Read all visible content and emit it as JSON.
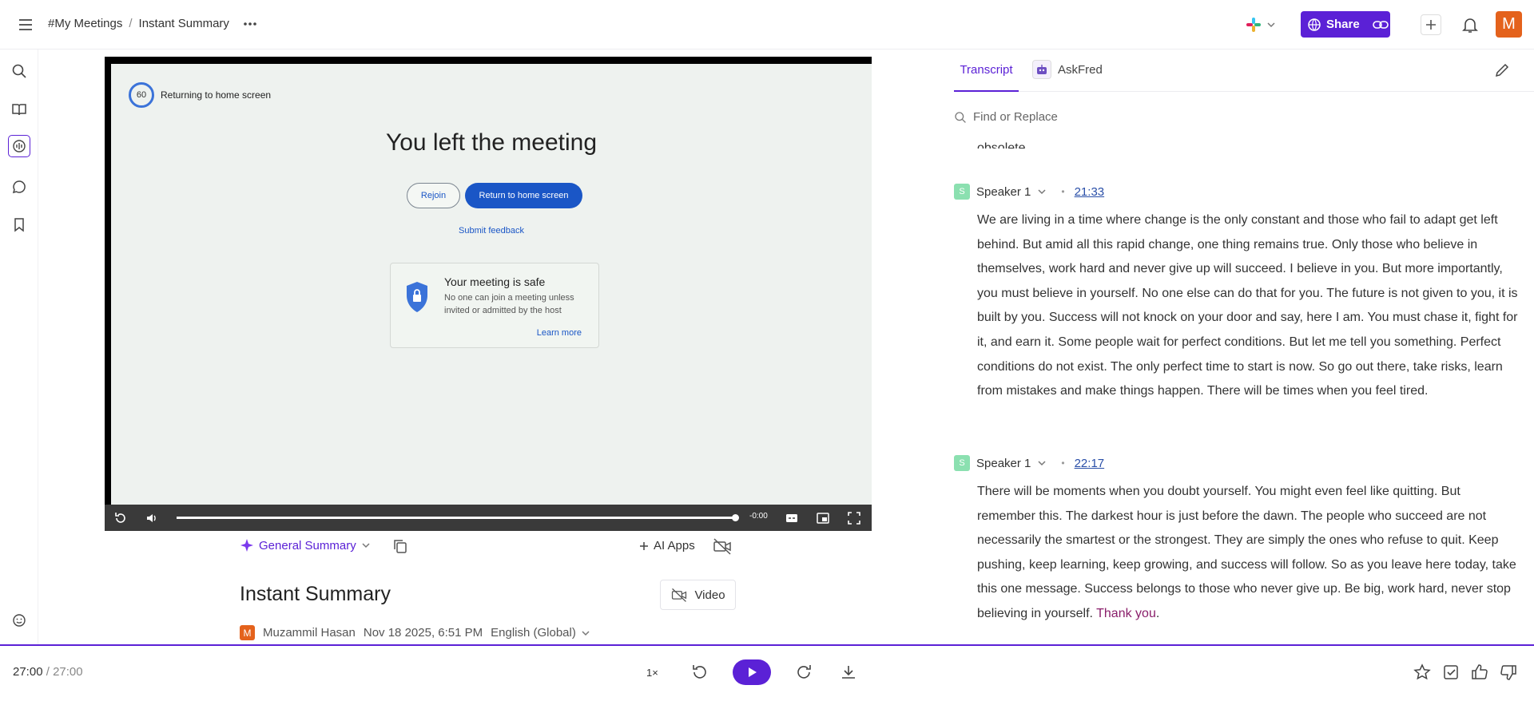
{
  "header": {
    "breadcrumbs": [
      "#My Meetings",
      "Instant Summary"
    ],
    "breadcrumb_sep": "/",
    "share_label": "Share",
    "avatar_letter": "M"
  },
  "video": {
    "timer": "60",
    "returning": "Returning to home screen",
    "title": "You left the meeting",
    "rejoin": "Rejoin",
    "return_home": "Return to home screen",
    "submit_feedback": "Submit feedback",
    "safe_title": "Your meeting is safe",
    "safe_desc": "No one can join a meeting unless invited or admitted by the host",
    "learn_more": "Learn more",
    "time_remaining": "-0:00",
    "progress": 1.0
  },
  "summary": {
    "general_summary": "General Summary",
    "ai_apps": "AI Apps",
    "title": "Instant Summary",
    "video_label": "Video",
    "author_initial": "M",
    "author": "Muzammil Hasan",
    "date": "Nov 18 2025, 6:51 PM",
    "language": "English (Global)"
  },
  "transcript": {
    "tab_transcript": "Transcript",
    "tab_askfred": "AskFred",
    "search_placeholder": "Find or Replace",
    "cut_text": "obsolete.",
    "entries": [
      {
        "speaker_initial": "S",
        "speaker": "Speaker 1",
        "timestamp": "21:33",
        "text": "We are living in a time where change is the only constant and those who fail to adapt get left behind. But amid all this rapid change, one thing remains true. Only those who believe in themselves, work hard and never give up will succeed. I believe in you. But more importantly, you must believe in yourself. No one else can do that for you. The future is not given to you, it is built by you. Success will not knock on your door and say, here I am. You must chase it, fight for it, and earn it. Some people wait for perfect conditions. But let me tell you something. Perfect conditions do not exist. The only perfect time to start is now. So go out there, take risks, learn from mistakes and make things happen. There will be times when you feel tired."
      },
      {
        "speaker_initial": "S",
        "speaker": "Speaker 1",
        "timestamp": "22:17",
        "text": "There will be moments when you doubt yourself. You might even feel like quitting. But remember this. The darkest hour is just before the dawn. The people who succeed are not necessarily the smartest or the strongest. They are simply the ones who refuse to quit. Keep pushing, keep learning, keep growing, and success will follow. So as you leave here today, take this one message. Success belongs to those who never give up. Be big, work hard, never stop believing in yourself.",
        "highlight": "Thank you",
        "tail": "."
      }
    ]
  },
  "player": {
    "current_time": "27:00",
    "sep": "/",
    "total_time": "27:00",
    "speed": "1×",
    "accent": "#5b21d6"
  }
}
